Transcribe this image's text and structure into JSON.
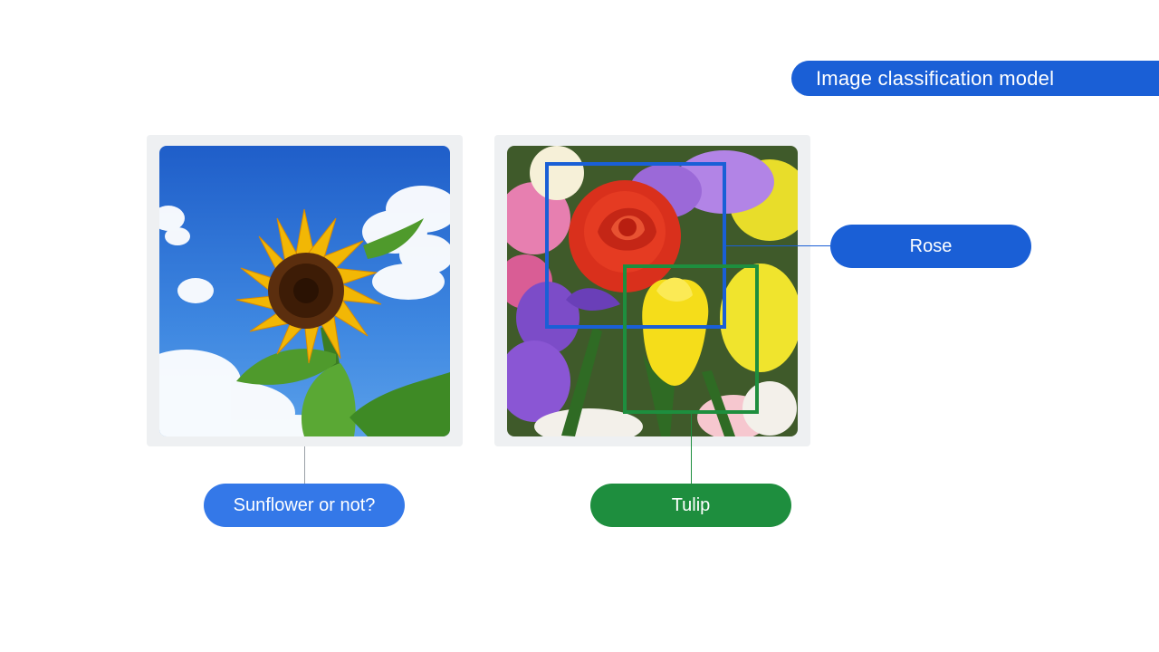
{
  "title": {
    "label": "Image classification model",
    "color": "#1a5fd6"
  },
  "images": {
    "left": {
      "subject": "sunflower-photo"
    },
    "right": {
      "subject": "flower-bouquet-photo"
    }
  },
  "labels": {
    "sunflower_question": "Sunflower or not?",
    "rose": "Rose",
    "tulip": "Tulip"
  },
  "boxes": {
    "rose": {
      "color": "#1a5fd6"
    },
    "tulip": {
      "color": "#1e8e3e"
    }
  }
}
